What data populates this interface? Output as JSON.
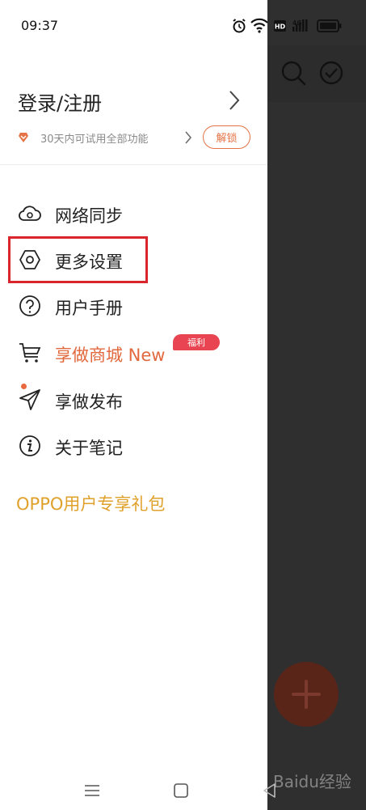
{
  "status_bar": {
    "time": "09:37",
    "icons": [
      "alarm-icon",
      "wifi-icon",
      "hd-icon",
      "4g-signal-icon",
      "battery-icon"
    ],
    "hd_text": "HD",
    "network_text": "4G"
  },
  "drawer": {
    "login_label": "登录/注册",
    "trial_text": "30天内可试用全部功能",
    "unlock_label": "解锁",
    "menu": [
      {
        "label": "网络同步",
        "icon": "cloud-sync-icon"
      },
      {
        "label": "更多设置",
        "icon": "settings-hexagon-icon"
      },
      {
        "label": "用户手册",
        "icon": "help-circle-icon"
      },
      {
        "label": "享做商城 New",
        "icon": "cart-icon"
      },
      {
        "label": "享做发布",
        "icon": "send-icon"
      },
      {
        "label": "关于笔记",
        "icon": "info-circle-icon"
      }
    ],
    "welfare_badge": "福利",
    "oppo_gift": "OPPO用户专享礼包"
  },
  "background_app": {
    "icons": [
      "search-icon",
      "check-circle-icon",
      "plus-icon"
    ]
  },
  "nav_bar": {
    "icons": [
      "menu-icon",
      "home-icon",
      "back-icon"
    ]
  },
  "watermark": "Baidu经验",
  "colors": {
    "accent": "#e57345",
    "gift": "#e0a12a",
    "highlight": "#d8262c",
    "badge": "#e94451"
  }
}
